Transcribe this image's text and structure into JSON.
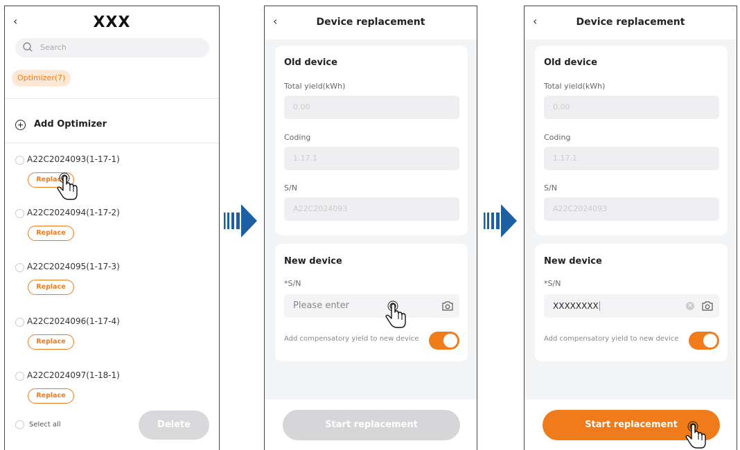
{
  "colors": {
    "accent": "#ef7b1a",
    "disabled": "#d6d6d9",
    "arrow": "#1d5fa3"
  },
  "screen1": {
    "title": "XXX",
    "search_placeholder": "Search",
    "chip": "Optimizer(7)",
    "add_label": "Add Optimizer",
    "items": [
      {
        "name": "A22C2024093(1-17-1)",
        "button": "Replace"
      },
      {
        "name": "A22C2024094(1-17-2)",
        "button": "Replace"
      },
      {
        "name": "A22C2024095(1-17-3)",
        "button": "Replace"
      },
      {
        "name": "A22C2024096(1-17-4)",
        "button": "Replace"
      },
      {
        "name": "A22C2024097(1-18-1)",
        "button": "Replace"
      }
    ],
    "select_all": "Select all",
    "delete": "Delete"
  },
  "screen2": {
    "title": "Device replacement",
    "old_title": "Old device",
    "yield_label": "Total yield(kWh)",
    "yield_value": "0.00",
    "coding_label": "Coding",
    "coding_value": "1.17.1",
    "sn_label": "S/N",
    "sn_value": "A22C2024093",
    "new_title": "New device",
    "new_sn_label": "*S/N",
    "new_sn_placeholder": "Please enter",
    "comp_label": "Add compensatory yield to new device",
    "start": "Start replacement"
  },
  "screen3": {
    "title": "Device replacement",
    "old_title": "Old device",
    "yield_label": "Total yield(kWh)",
    "yield_value": "0.00",
    "coding_label": "Coding",
    "coding_value": "1.17.1",
    "sn_label": "S/N",
    "sn_value": "A22C2024093",
    "new_title": "New device",
    "new_sn_label": "*S/N",
    "new_sn_value": "XXXXXXXX",
    "comp_label": "Add compensatory yield to new device",
    "start": "Start replacement"
  }
}
